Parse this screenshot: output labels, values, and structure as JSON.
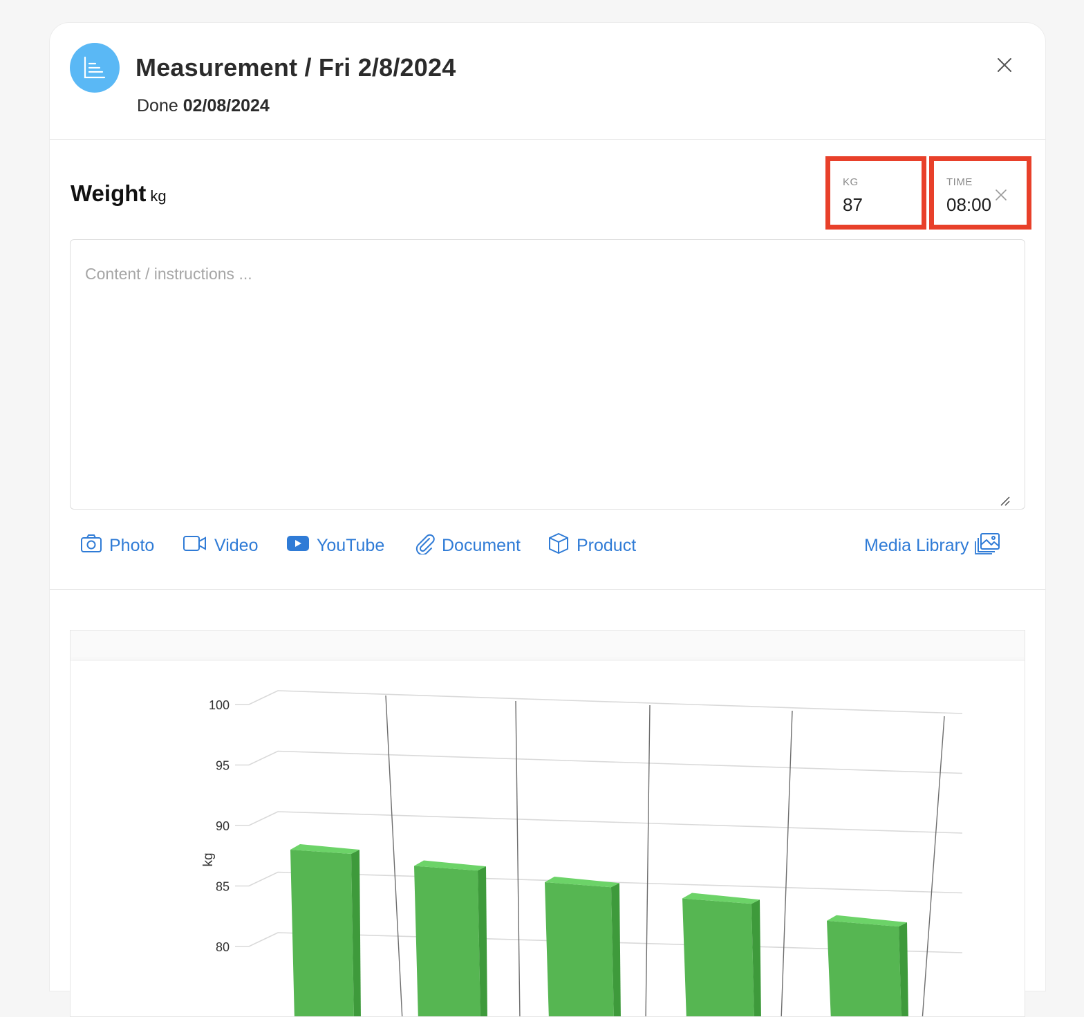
{
  "header": {
    "title": "Measurement / Fri 2/8/2024",
    "status_label": "Done",
    "status_date": "02/08/2024"
  },
  "weight": {
    "title": "Weight",
    "unit": "kg",
    "kg_label": "KG",
    "kg_value": "87",
    "time_label": "TIME",
    "time_value": "08:00"
  },
  "content": {
    "placeholder": "Content / instructions ..."
  },
  "media": {
    "photo": "Photo",
    "video": "Video",
    "youtube": "YouTube",
    "document": "Document",
    "product": "Product",
    "library": "Media Library"
  },
  "colors": {
    "accent": "#2f7bd6",
    "icon_bg": "#5ab8f5",
    "highlight": "#e8402a",
    "bar_front": "#56b652",
    "bar_top": "#6cd368",
    "bar_side": "#3e9a3b"
  },
  "chart_data": {
    "type": "bar",
    "ylabel": "kg",
    "ylim": [
      80,
      100
    ],
    "yticks": [
      "100",
      "95",
      "90",
      "85",
      "80"
    ],
    "values": [
      88,
      87,
      86,
      85,
      83.5
    ],
    "three_d": true,
    "grid": true
  }
}
